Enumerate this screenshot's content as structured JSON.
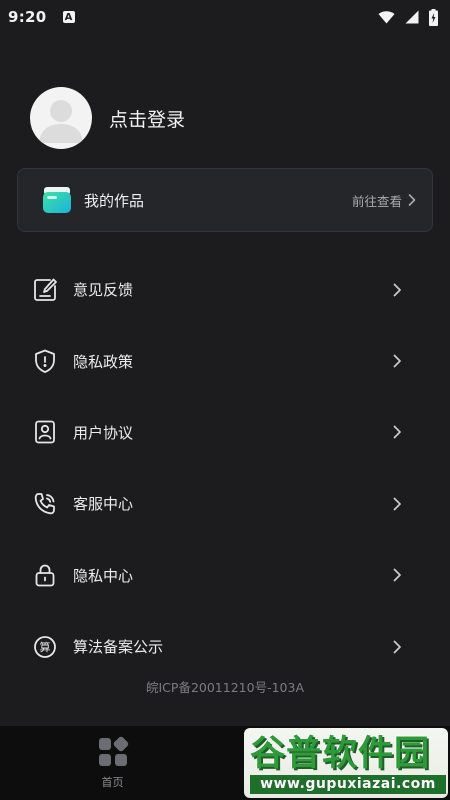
{
  "status_bar": {
    "time": "9:20",
    "notification_badge": "A"
  },
  "profile": {
    "login_label": "点击登录"
  },
  "works_card": {
    "title": "我的作品",
    "link_label": "前往查看"
  },
  "menu": {
    "items": [
      {
        "label": "意见反馈",
        "icon": "feedback-icon"
      },
      {
        "label": "隐私政策",
        "icon": "shield-icon"
      },
      {
        "label": "用户协议",
        "icon": "user-agreement-icon"
      },
      {
        "label": "客服中心",
        "icon": "phone-icon"
      },
      {
        "label": "隐私中心",
        "icon": "lock-icon"
      },
      {
        "label": "算法备案公示",
        "icon": "algorithm-icon"
      }
    ]
  },
  "icp_text": "皖ICP备20011210号-103A",
  "bottom_nav": {
    "tabs": [
      {
        "label": "首页",
        "icon": "home-grid-icon"
      }
    ]
  },
  "watermark": {
    "title": "谷普软件园",
    "url": "www.gupuxiazai.com"
  },
  "colors": {
    "background": "#1c1c1f",
    "card": "#25262a",
    "nav_background": "#0d0d0e",
    "text_primary": "#ececee",
    "text_secondary": "#a9aab0",
    "icp_text": "#7b7c82",
    "watermark_green": "#2f9a3a"
  }
}
